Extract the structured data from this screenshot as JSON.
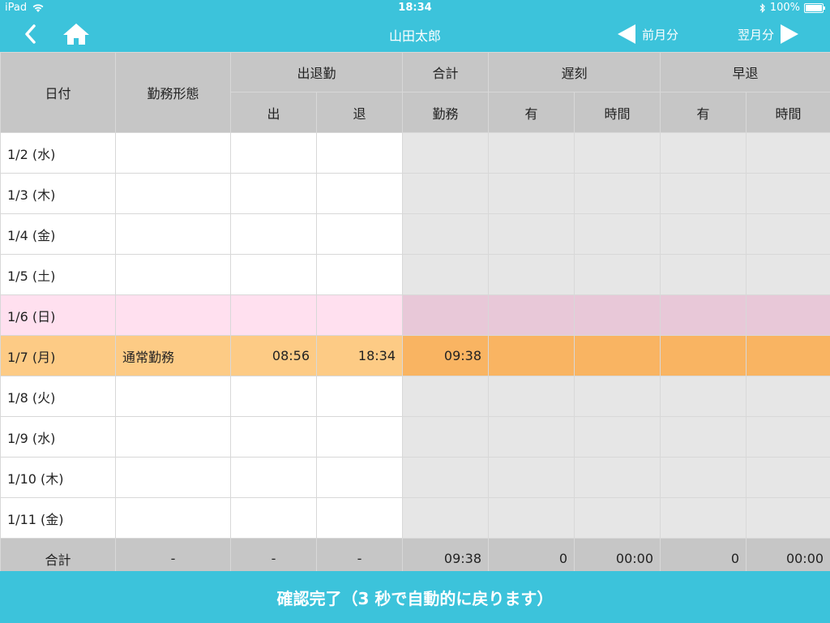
{
  "status_bar": {
    "device": "iPad",
    "time": "18:34",
    "battery": "100%"
  },
  "nav": {
    "title": "山田太郎",
    "prev_label": "前月分",
    "next_label": "翌月分"
  },
  "colors": {
    "accent": "#3cc3db",
    "header_gray": "#c6c6c6",
    "sunday": "#ffe0ef",
    "today": "#fdcb85",
    "today_dark": "#f9b462"
  },
  "table": {
    "headers": {
      "date": "日付",
      "work_type": "勤務形態",
      "attendance": "出退勤",
      "total": "合計",
      "late": "遅刻",
      "early_leave": "早退",
      "in": "出",
      "out": "退",
      "work": "勤務",
      "late_has": "有",
      "late_time": "時間",
      "early_has": "有",
      "early_time": "時間"
    },
    "rows": [
      {
        "date": "1/2 (水)",
        "type": "",
        "in": "",
        "out": "",
        "work": "",
        "late_has": "",
        "late_time": "",
        "early_has": "",
        "early_time": ""
      },
      {
        "date": "1/3 (木)",
        "type": "",
        "in": "",
        "out": "",
        "work": "",
        "late_has": "",
        "late_time": "",
        "early_has": "",
        "early_time": ""
      },
      {
        "date": "1/4 (金)",
        "type": "",
        "in": "",
        "out": "",
        "work": "",
        "late_has": "",
        "late_time": "",
        "early_has": "",
        "early_time": ""
      },
      {
        "date": "1/5 (土)",
        "type": "",
        "in": "",
        "out": "",
        "work": "",
        "late_has": "",
        "late_time": "",
        "early_has": "",
        "early_time": ""
      },
      {
        "date": "1/6 (日)",
        "type": "",
        "in": "",
        "out": "",
        "work": "",
        "late_has": "",
        "late_time": "",
        "early_has": "",
        "early_time": ""
      },
      {
        "date": "1/7 (月)",
        "type": "通常勤務",
        "in": "08:56",
        "out": "18:34",
        "work": "09:38",
        "late_has": "",
        "late_time": "",
        "early_has": "",
        "early_time": ""
      },
      {
        "date": "1/8 (火)",
        "type": "",
        "in": "",
        "out": "",
        "work": "",
        "late_has": "",
        "late_time": "",
        "early_has": "",
        "early_time": ""
      },
      {
        "date": "1/9 (水)",
        "type": "",
        "in": "",
        "out": "",
        "work": "",
        "late_has": "",
        "late_time": "",
        "early_has": "",
        "early_time": ""
      },
      {
        "date": "1/10 (木)",
        "type": "",
        "in": "",
        "out": "",
        "work": "",
        "late_has": "",
        "late_time": "",
        "early_has": "",
        "early_time": ""
      },
      {
        "date": "1/11 (金)",
        "type": "",
        "in": "",
        "out": "",
        "work": "",
        "late_has": "",
        "late_time": "",
        "early_has": "",
        "early_time": ""
      }
    ],
    "footer": {
      "label": "合計",
      "type": "-",
      "in": "-",
      "out": "-",
      "work": "09:38",
      "late_has": "0",
      "late_time": "00:00",
      "early_has": "0",
      "early_time": "00:00"
    }
  },
  "confirm_text": "確認完了（3 秒で自動的に戻ります）"
}
